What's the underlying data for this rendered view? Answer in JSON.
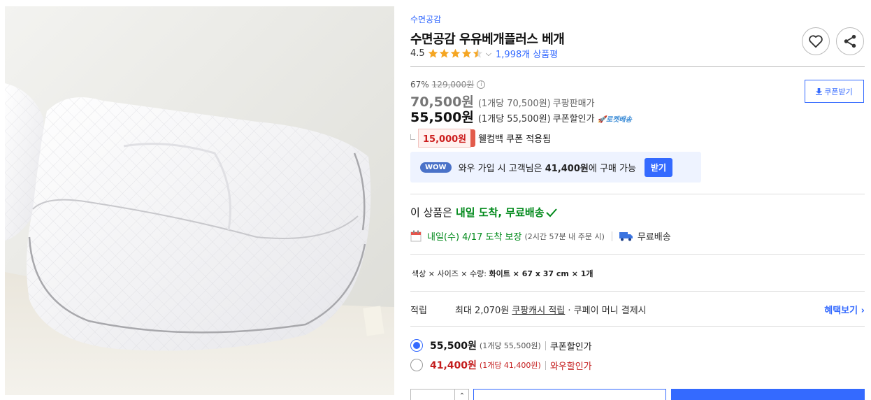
{
  "product": {
    "brand": "수면공감",
    "title": "수면공감 우유베개플러스 베개",
    "rating": "4.5",
    "review_count": "1,998개 상품평",
    "stars_value": 4.5
  },
  "price": {
    "discount": "67%",
    "original": "129,000원",
    "sale_price": "70,500원",
    "sale_unit": "(1개당 70,500원)",
    "sale_label": "쿠팡판매가",
    "coupon_price": "55,500원",
    "coupon_unit": "(1개당 55,500원)",
    "coupon_label": "쿠폰할인가",
    "rocket_label": "로켓배송",
    "coupon_button": "쿠폰받기",
    "welcome_coupon_amount": "15,000원",
    "welcome_coupon_text": "웰컴백 쿠폰 적용됨"
  },
  "wow": {
    "badge": "WOW",
    "text_prefix": "와우 가입 시 고객님은 ",
    "text_price": "41,400원",
    "text_suffix": "에 구매 가능",
    "button": "받기"
  },
  "delivery": {
    "prefix": "이 상품은",
    "highlight": "내일 도착, 무료배송",
    "date_text": "내일(수) 4/17 도착 보장",
    "deadline": "(2시간 57분 내 주문 시)",
    "free_shipping": "무료배송"
  },
  "options": {
    "label_prefix": "색상 × 사이즈 × 수량:",
    "value": "화이트 × 67 x 37 cm × 1개"
  },
  "reward": {
    "label": "적립",
    "text_prefix": "최대 2,070원 ",
    "text_link": "쿠팡캐시 적립",
    "text_suffix": " · 쿠페이 머니 결제시",
    "benefit_link": "혜택보기"
  },
  "price_options": [
    {
      "price": "55,500원",
      "unit": "(1개당 55,500원)",
      "label": "쿠폰할인가",
      "selected": true
    },
    {
      "price": "41,400원",
      "unit": "(1개당 41,400원)",
      "label": "와우할인가",
      "selected": false
    }
  ],
  "colors": {
    "accent": "#346aff",
    "green": "#00891a",
    "red": "#c41d1d"
  }
}
